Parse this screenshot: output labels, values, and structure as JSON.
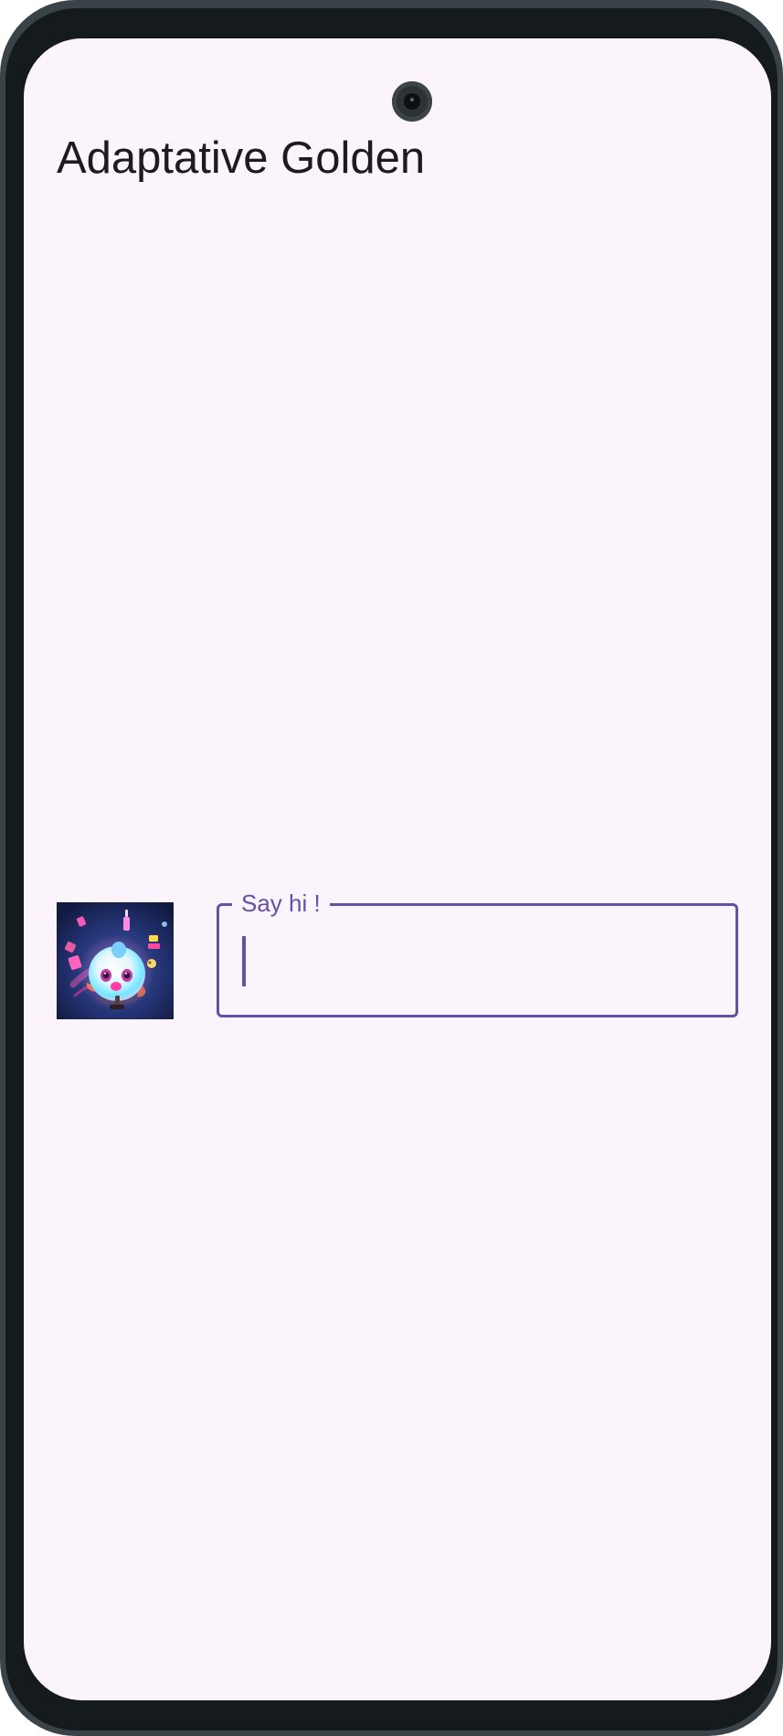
{
  "app": {
    "title": "Adaptative Golden"
  },
  "avatar": {
    "icon": "character-illustration-icon"
  },
  "message_field": {
    "label": "Say hi !",
    "value": ""
  },
  "colors": {
    "background": "#fcf4fc",
    "accent": "#6650a4",
    "text": "#1d1b20",
    "device_frame": "#151a1c"
  }
}
